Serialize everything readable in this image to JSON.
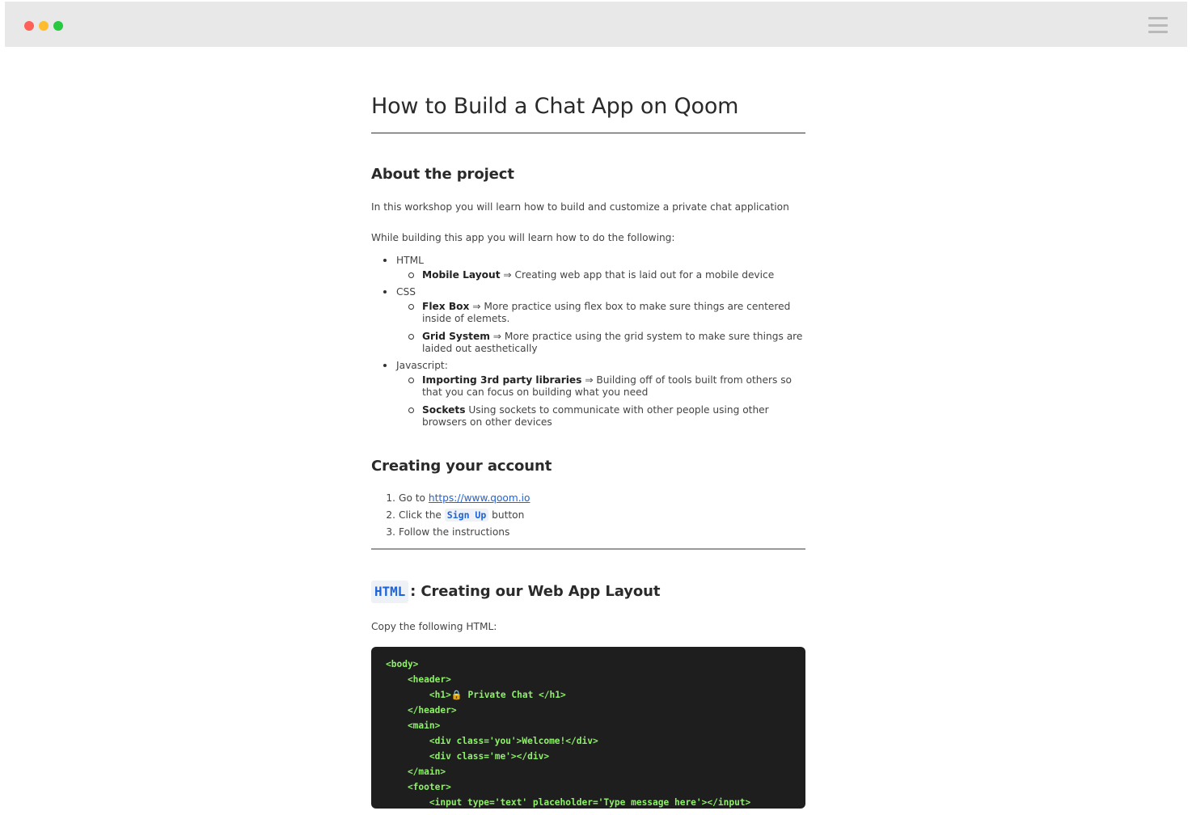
{
  "window": {
    "controls": [
      "close",
      "minimize",
      "maximize"
    ],
    "menu_icon": "hamburger-menu-icon"
  },
  "page": {
    "title": "How to Build a Chat App on Qoom",
    "about": {
      "heading": "About the project",
      "intro": "In this workshop you will learn how to build and customize a private chat application",
      "while_text": "While building this app you will learn how to do the following:",
      "topics": [
        {
          "label": "HTML",
          "items": [
            {
              "bold": "Mobile Layout",
              "text": " ⇒ Creating web app that is laid out for a mobile device"
            }
          ]
        },
        {
          "label": "CSS",
          "items": [
            {
              "bold": "Flex Box",
              "text": " ⇒ More practice using flex box to make sure things are centered inside of elemets."
            },
            {
              "bold": "Grid System",
              "text": " ⇒ More practice using the grid system to make sure things are laided out aesthetically"
            }
          ]
        },
        {
          "label": "Javascript:",
          "items": [
            {
              "bold": "Importing 3rd party libraries",
              "text": " ⇒ Building off of tools built from others so that you can focus on building what you need"
            },
            {
              "bold": "Sockets",
              "text": " Using sockets to communicate with other people using other browsers on other devices"
            }
          ]
        }
      ]
    },
    "account": {
      "heading": "Creating your account",
      "steps": [
        {
          "num": "1.",
          "prefix": "Go to ",
          "link": "https://www.qoom.io"
        },
        {
          "num": "2.",
          "prefix": "Click the ",
          "code": "Sign Up",
          "suffix": " button"
        },
        {
          "num": "3.",
          "prefix": "Follow the instructions"
        }
      ]
    },
    "html_section": {
      "badge": "HTML",
      "heading": ": Creating our Web App Layout",
      "copy_text": "Copy the following HTML:",
      "code_lines": [
        "<body>",
        "    <header>",
        "        <h1>🔒 Private Chat </h1>",
        "    </header>",
        "    <main>",
        "        <div class='you'>Welcome!</div>",
        "        <div class='me'></div>",
        "    </main>",
        "    <footer>",
        "        <input type='text' placeholder='Type message here'></input>"
      ]
    }
  }
}
